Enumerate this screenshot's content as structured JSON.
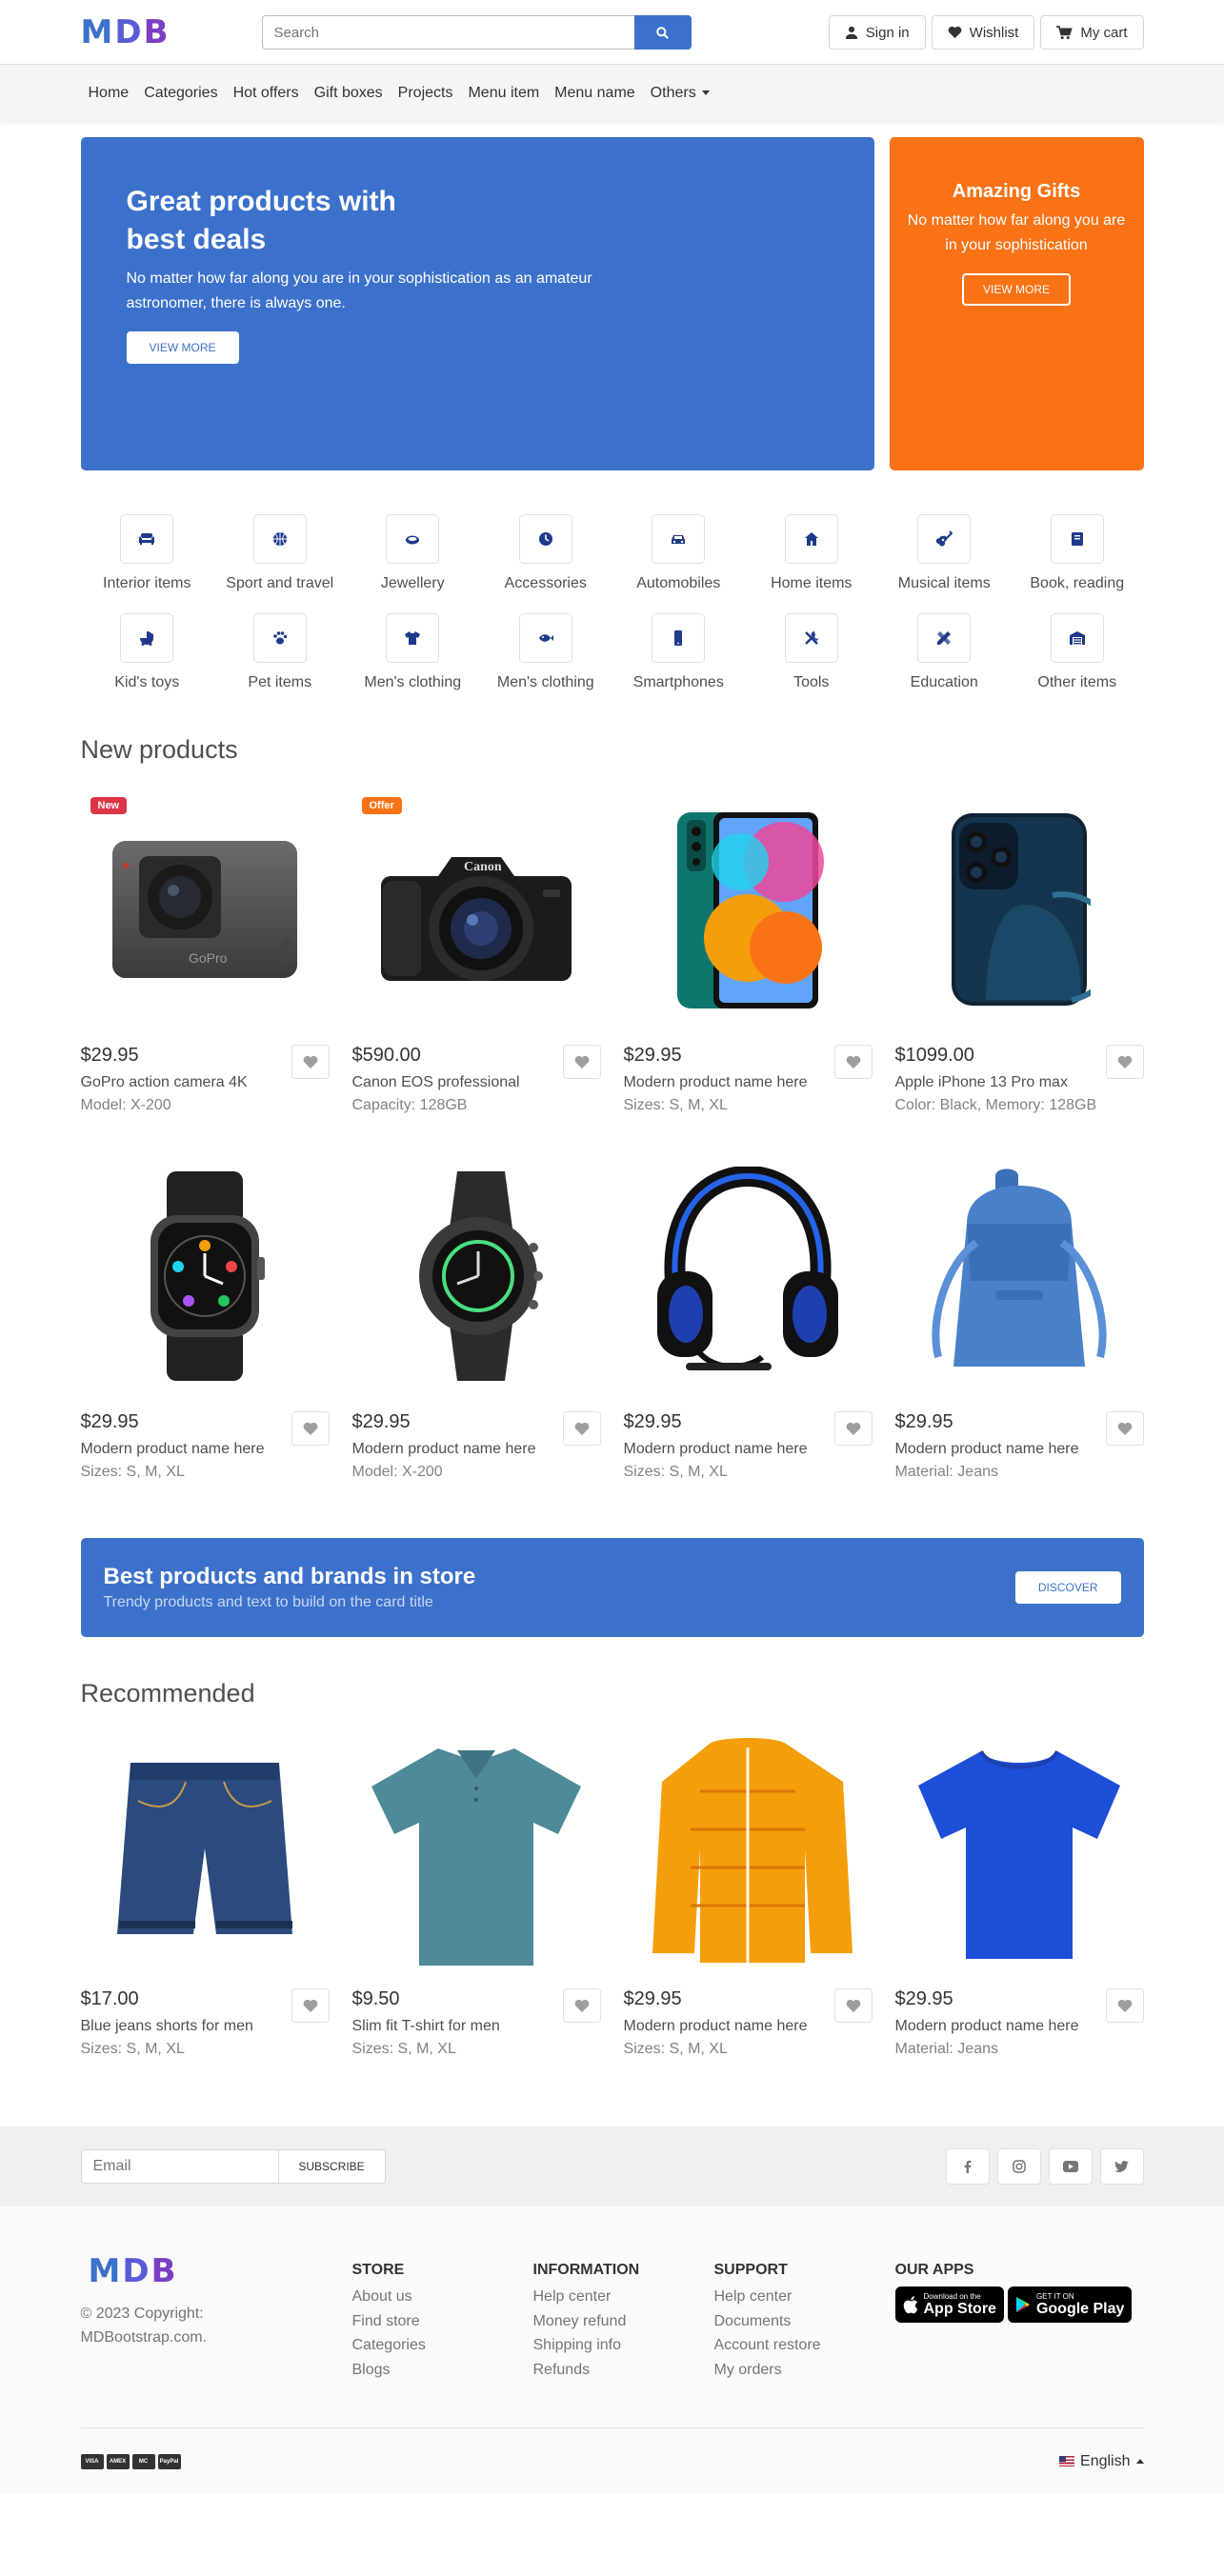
{
  "header": {
    "logo": "MDB",
    "search_placeholder": "Search",
    "signin": "Sign in",
    "wishlist": "Wishlist",
    "cart": "My cart"
  },
  "nav": [
    "Home",
    "Categories",
    "Hot offers",
    "Gift boxes",
    "Projects",
    "Menu item",
    "Menu name",
    "Others"
  ],
  "hero": {
    "title_line1": "Great products with",
    "title_line2": "best deals",
    "text": "No matter how far along you are in your sophistication as an amateur astronomer, there is always one.",
    "button": "View more",
    "side_title": "Amazing Gifts",
    "side_text": "No matter how far along you are in your sophistication",
    "side_button": "View more",
    "main_color": "#3b71ca",
    "side_color": "#f97316"
  },
  "categories": [
    {
      "label": "Interior items",
      "icon": "couch-icon"
    },
    {
      "label": "Sport and travel",
      "icon": "basketball-icon"
    },
    {
      "label": "Jewellery",
      "icon": "ring-icon"
    },
    {
      "label": "Accessories",
      "icon": "clock-icon"
    },
    {
      "label": "Automobiles",
      "icon": "car-icon"
    },
    {
      "label": "Home items",
      "icon": "home-icon"
    },
    {
      "label": "Musical items",
      "icon": "guitar-icon"
    },
    {
      "label": "Book, reading",
      "icon": "book-icon"
    },
    {
      "label": "Kid's toys",
      "icon": "baby-carriage-icon"
    },
    {
      "label": "Pet items",
      "icon": "paw-icon"
    },
    {
      "label": "Men's clothing",
      "icon": "tshirt-icon"
    },
    {
      "label": "Men's clothing",
      "icon": "fish-icon"
    },
    {
      "label": "Smartphones",
      "icon": "mobile-icon"
    },
    {
      "label": "Tools",
      "icon": "tools-icon"
    },
    {
      "label": "Education",
      "icon": "pencil-ruler-icon"
    },
    {
      "label": "Other items",
      "icon": "warehouse-icon"
    }
  ],
  "new_products": {
    "title": "New products",
    "items": [
      {
        "price": "$29.95",
        "name": "GoPro action camera 4K",
        "meta": "Model: X-200",
        "badge": "New",
        "badge_color": "#dc3545",
        "img": "action-camera"
      },
      {
        "price": "$590.00",
        "name": "Canon EOS professional",
        "meta": "Capacity: 128GB",
        "badge": "Offer",
        "badge_color": "#f97316",
        "img": "dslr-camera"
      },
      {
        "price": "$29.95",
        "name": "Modern product name here",
        "meta": "Sizes: S, M, XL",
        "badge": "",
        "img": "android-phone"
      },
      {
        "price": "$1099.00",
        "name": "Apple iPhone 13 Pro max",
        "meta": "Color: Black, Memory: 128GB",
        "badge": "",
        "img": "iphone"
      },
      {
        "price": "$29.95",
        "name": "Modern product name here",
        "meta": "Sizes: S, M, XL",
        "badge": "",
        "img": "apple-watch"
      },
      {
        "price": "$29.95",
        "name": "Modern product name here",
        "meta": "Model: X-200",
        "badge": "",
        "img": "round-watch"
      },
      {
        "price": "$29.95",
        "name": "Modern product name here",
        "meta": "Sizes: S, M, XL",
        "badge": "",
        "img": "headphones"
      },
      {
        "price": "$29.95",
        "name": "Modern product name here",
        "meta": "Material: Jeans",
        "badge": "",
        "img": "backpack"
      }
    ]
  },
  "banner": {
    "title": "Best products and brands in store",
    "subtitle": "Trendy products and text to build on the card title",
    "button": "Discover"
  },
  "recommended": {
    "title": "Recommended",
    "items": [
      {
        "price": "$17.00",
        "name": "Blue jeans shorts for men",
        "meta": "Sizes: S, M, XL",
        "img": "jeans-shorts"
      },
      {
        "price": "$9.50",
        "name": "Slim fit T-shirt for men",
        "meta": "Sizes: S, M, XL",
        "img": "polo-shirt"
      },
      {
        "price": "$29.95",
        "name": "Modern product name here",
        "meta": "Sizes: S, M, XL",
        "img": "puffer-jacket"
      },
      {
        "price": "$29.95",
        "name": "Modern product name here",
        "meta": "Material: Jeans",
        "img": "blue-tshirt"
      }
    ]
  },
  "newsletter": {
    "placeholder": "Email",
    "button": "Subscribe",
    "social": [
      "facebook-icon",
      "instagram-icon",
      "youtube-icon",
      "twitter-icon"
    ]
  },
  "footer": {
    "logo": "MDB",
    "copyright_line1": "© 2023 Copyright:",
    "copyright_line2": "MDBootstrap.com.",
    "columns": [
      {
        "title": "Store",
        "links": [
          "About us",
          "Find store",
          "Categories",
          "Blogs"
        ]
      },
      {
        "title": "Information",
        "links": [
          "Help center",
          "Money refund",
          "Shipping info",
          "Refunds"
        ]
      },
      {
        "title": "Support",
        "links": [
          "Help center",
          "Documents",
          "Account restore",
          "My orders"
        ]
      }
    ],
    "apps_title": "Our apps",
    "app_store_small": "Download on the",
    "app_store": "App Store",
    "google_play_small": "GET IT ON",
    "google_play": "Google Play",
    "payment_cards": [
      "VISA",
      "AMEX",
      "MC",
      "PayPal"
    ],
    "language": "English"
  }
}
